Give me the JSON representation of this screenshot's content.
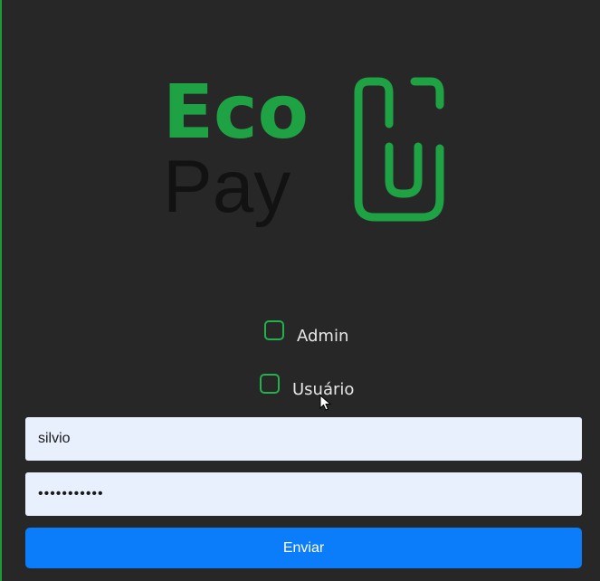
{
  "brand": {
    "word_top": "Eco",
    "word_bottom": "Pay",
    "color_green": "#1fa243",
    "color_dark": "#121212"
  },
  "role_options": [
    {
      "label": "Admin",
      "checked": false
    },
    {
      "label": "Usuário",
      "checked": false
    }
  ],
  "form": {
    "username_value": "silvio",
    "password_value": "•••••••••••",
    "submit_label": "Enviar"
  },
  "colors": {
    "background": "#272727",
    "accent": "#22b14c",
    "button": "#0b7dfb",
    "input_bg": "#e8f0fe"
  },
  "icons": {
    "logo_mark": "eco-pay-clip-icon",
    "pointer": "mouse-pointer-icon"
  }
}
